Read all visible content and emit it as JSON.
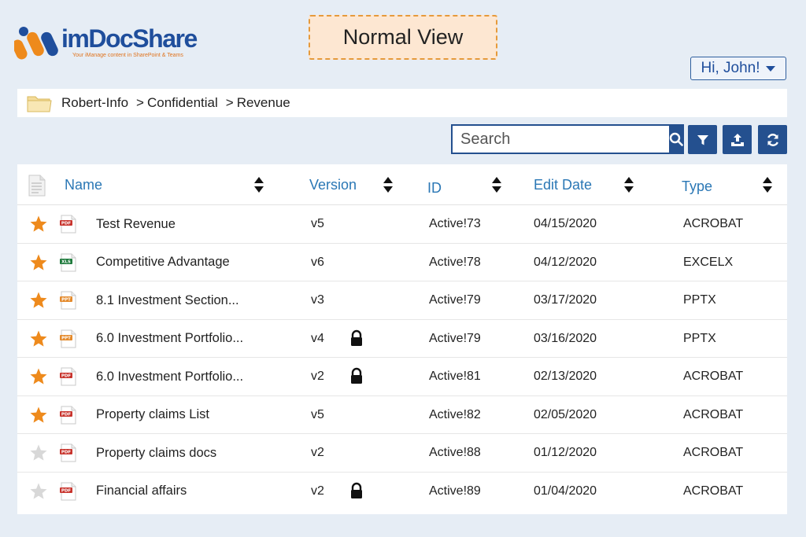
{
  "app": {
    "brand_prefix": "im",
    "brand_name": "DocShare",
    "tagline": "Your iManage content in SharePoint & Teams",
    "view_mode": "Normal View"
  },
  "user_menu": {
    "label": "Hi, John!"
  },
  "breadcrumb": [
    "Robert-Info",
    "Confidential",
    "Revenue"
  ],
  "breadcrumb_sep": ">",
  "search": {
    "placeholder": "Search",
    "value": ""
  },
  "columns": [
    "Name",
    "Version",
    "ID",
    "Edit Date",
    "Type"
  ],
  "rows": [
    {
      "favorite": true,
      "icon": "pdf-file-icon",
      "name": "Test Revenue",
      "version": "v5",
      "locked": false,
      "id": "Active!73",
      "edit_date": "04/15/2020",
      "type": "ACROBAT"
    },
    {
      "favorite": true,
      "icon": "xls-file-icon",
      "name": "Competitive Advantage",
      "version": "v6",
      "locked": false,
      "id": "Active!78",
      "edit_date": "04/12/2020",
      "type": "EXCELX"
    },
    {
      "favorite": true,
      "icon": "ppt-file-icon",
      "name": "8.1 Investment Section...",
      "version": "v3",
      "locked": false,
      "id": "Active!79",
      "edit_date": "03/17/2020",
      "type": "PPTX"
    },
    {
      "favorite": true,
      "icon": "ppt-file-icon",
      "name": "6.0 Investment Portfolio...",
      "version": "v4",
      "locked": true,
      "id": "Active!79",
      "edit_date": "03/16/2020",
      "type": "PPTX"
    },
    {
      "favorite": true,
      "icon": "pdf-file-icon",
      "name": "6.0 Investment Portfolio...",
      "version": "v2",
      "locked": true,
      "id": "Active!81",
      "edit_date": "02/13/2020",
      "type": "ACROBAT"
    },
    {
      "favorite": true,
      "icon": "pdf-file-icon",
      "name": "Property claims List",
      "version": "v5",
      "locked": false,
      "id": "Active!82",
      "edit_date": "02/05/2020",
      "type": "ACROBAT"
    },
    {
      "favorite": false,
      "icon": "pdf-file-icon",
      "name": "Property claims docs",
      "version": "v2",
      "locked": false,
      "id": "Active!88",
      "edit_date": "01/12/2020",
      "type": "ACROBAT"
    },
    {
      "favorite": false,
      "icon": "pdf-file-icon",
      "name": "Financial affairs",
      "version": "v2",
      "locked": true,
      "id": "Active!89",
      "edit_date": "01/04/2020",
      "type": "ACROBAT"
    }
  ],
  "file_icon_labels": {
    "pdf": "PDF",
    "xls": "XLS",
    "ppt": "PPT"
  },
  "colors": {
    "accent": "#24508f",
    "header_link": "#2a77b5",
    "star_on": "#ee8a1c",
    "star_off": "#d8d8d8",
    "badge_bg": "#fde7d2",
    "badge_border": "#e69a3b"
  },
  "icons": {
    "search": "search-icon",
    "filter": "filter-icon",
    "upload": "upload-icon",
    "refresh": "refresh-icon",
    "folder": "folder-icon",
    "doc_column": "document-icon",
    "lock": "lock-icon",
    "star": "star-icon"
  }
}
